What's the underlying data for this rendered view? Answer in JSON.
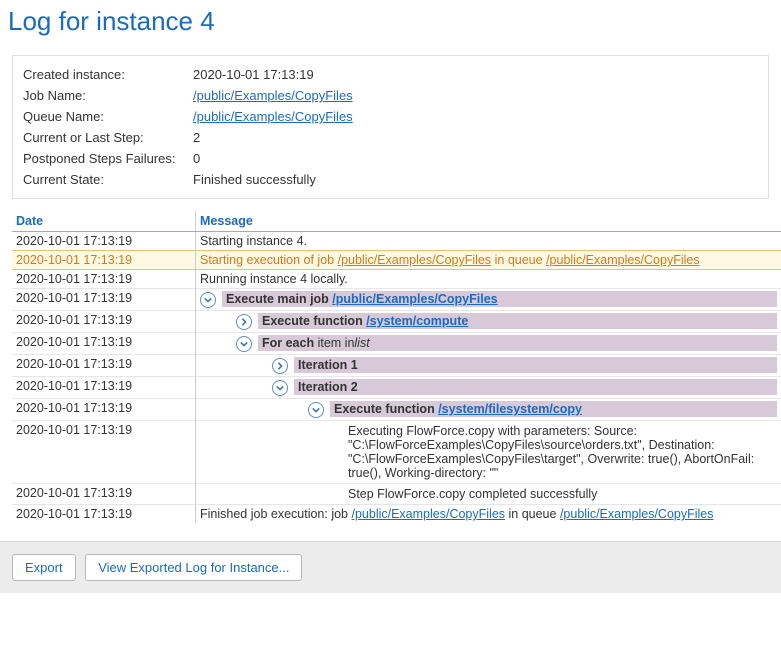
{
  "title": "Log for instance 4",
  "meta": {
    "created_label": "Created instance:",
    "created_value": "2020-10-01 17:13:19",
    "job_label": "Job Name:",
    "job_link": "/public/Examples/CopyFiles",
    "queue_label": "Queue Name:",
    "queue_link": "/public/Examples/CopyFiles",
    "step_label": "Current or Last Step:",
    "step_value": "2",
    "postponed_label": "Postponed Steps Failures:",
    "postponed_value": "0",
    "state_label": "Current State:",
    "state_value": "Finished successfully"
  },
  "headers": {
    "date": "Date",
    "message": "Message"
  },
  "rows": {
    "r0_date": "2020-10-01 17:13:19",
    "r0_msg": "Starting instance 4.",
    "r1_date": "2020-10-01 17:13:19",
    "r1_pre": "Starting execution of job ",
    "r1_link1": "/public/Examples/CopyFiles",
    "r1_mid": " in queue ",
    "r1_link2": "/public/Examples/CopyFiles",
    "r2_date": "2020-10-01 17:13:19",
    "r2_msg": "Running instance 4 locally.",
    "r3_date": "2020-10-01 17:13:19",
    "r3_bold": "Execute main job ",
    "r3_link": "/public/Examples/CopyFiles",
    "r4_date": "2020-10-01 17:13:19",
    "r4_bold": "Execute function ",
    "r4_link": "/system/compute",
    "r5_date": "2020-10-01 17:13:19",
    "r5_bold": "For each ",
    "r5_txt": "item in",
    "r5_it": "list",
    "r6_date": "2020-10-01 17:13:19",
    "r6_bold": "Iteration 1",
    "r7_date": "2020-10-01 17:13:19",
    "r7_bold": "Iteration 2",
    "r8_date": "2020-10-01 17:13:19",
    "r8_bold": "Execute function ",
    "r8_link": "/system/filesystem/copy",
    "r9_date": "2020-10-01 17:13:19",
    "r9_msg": "Executing FlowForce.copy with parameters: Source: \"C:\\FlowForceExamples\\CopyFiles\\source\\orders.txt\", Destination: \"C:\\FlowForceExamples\\CopyFiles\\target\", Overwrite: true(), AbortOnFail: true(), Working-directory: \"\"",
    "r10_date": "2020-10-01 17:13:19",
    "r10_msg": "Step FlowForce.copy completed successfully",
    "r11_date": "2020-10-01 17:13:19",
    "r11_pre": "Finished job execution: job ",
    "r11_link1": "/public/Examples/CopyFiles",
    "r11_mid": " in queue ",
    "r11_link2": "/public/Examples/CopyFiles"
  },
  "buttons": {
    "export": "Export",
    "view": "View Exported Log for Instance..."
  }
}
